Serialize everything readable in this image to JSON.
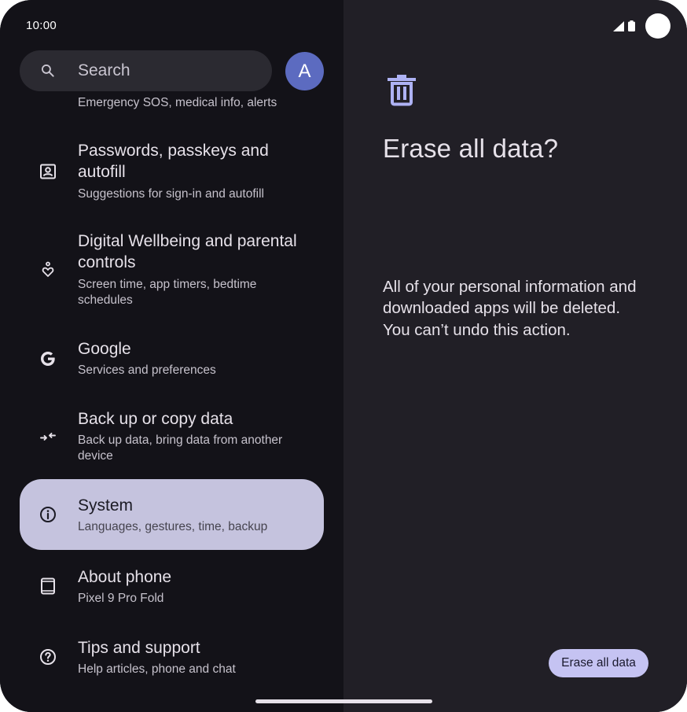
{
  "status_bar": {
    "time": "10:00"
  },
  "search": {
    "placeholder": "Search"
  },
  "account": {
    "avatar_letter": "A",
    "avatar_color": "#5c6bc0"
  },
  "settings_list": [
    {
      "title": "",
      "subtitle": "Emergency SOS, medical info, alerts"
    },
    {
      "title": "Passwords, passkeys and autofill",
      "subtitle": "Suggestions for sign-in and autofill",
      "icon": "person-card-icon"
    },
    {
      "title": "Digital Wellbeing and parental controls",
      "subtitle": "Screen time, app timers, bedtime schedules",
      "icon": "heart-person-icon"
    },
    {
      "title": "Google",
      "subtitle": "Services and preferences",
      "icon": "google-icon"
    },
    {
      "title": "Back up or copy data",
      "subtitle": "Back up data, bring data from another device",
      "icon": "transfer-arrows-icon"
    },
    {
      "title": "System",
      "subtitle": "Languages, gestures, time, backup",
      "icon": "info-icon",
      "selected": true
    },
    {
      "title": "About phone",
      "subtitle": "Pixel 9 Pro Fold",
      "icon": "phone-icon"
    },
    {
      "title": "Tips and support",
      "subtitle": "Help articles, phone and chat",
      "icon": "help-icon"
    }
  ],
  "detail": {
    "icon": "trash-icon",
    "title": "Erase all data?",
    "body": "All of your personal information and downloaded apps will be deleted. You can’t undo this action.",
    "button_label": "Erase all data"
  },
  "colors": {
    "left_background": "#131218",
    "right_background": "#211f26",
    "selected_item": "#c5c3de",
    "accent_button": "#c5c3f2",
    "icon_accent": "#aeb2f4"
  }
}
